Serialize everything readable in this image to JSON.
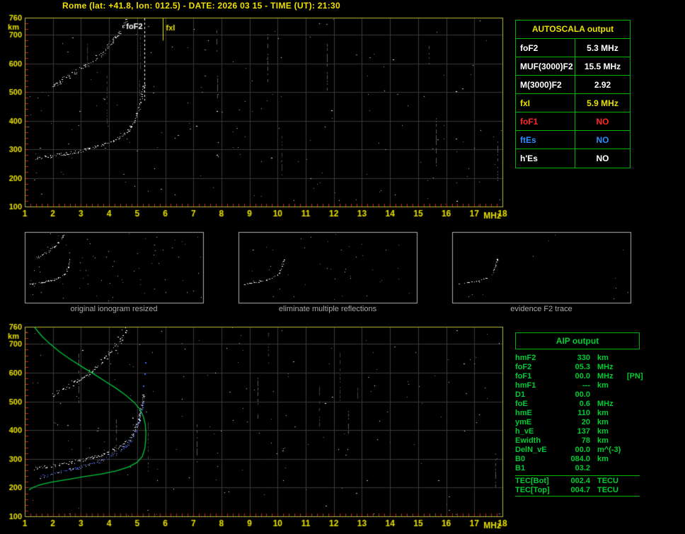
{
  "header": {
    "title": "Rome (lat: +41.8, lon: 012.5) - DATE: 2026 03 15 - TIME (UT): 21:30"
  },
  "colors": {
    "background": "#000000",
    "title": "#f0e000",
    "axis_label": "#e8e000",
    "plot_border": "#b8b83c",
    "grid": "#3a3a3a",
    "tick": "#cc2020",
    "trace": "#ffffff",
    "profile": "#00c83c",
    "restored_trace": "#4664ff",
    "table_border": "#00b400",
    "table_title": "#e8e000",
    "aip_text": "#00cc33",
    "caption": "#a8a8a8",
    "thumb_border": "#b0b0b0",
    "red": "#ff2828",
    "blue": "#2f8cff",
    "white": "#ffffff",
    "yellow": "#e8e000"
  },
  "autoscala_table": {
    "title": "AUTOSCALA output",
    "rows": [
      {
        "label": "foF2",
        "value": "5.3 MHz",
        "label_color": "#ffffff",
        "value_color": "#ffffff"
      },
      {
        "label": "MUF(3000)F2",
        "value": "15.5 MHz",
        "label_color": "#ffffff",
        "value_color": "#ffffff"
      },
      {
        "label": "M(3000)F2",
        "value": "2.92",
        "label_color": "#ffffff",
        "value_color": "#ffffff"
      },
      {
        "label": "fxI",
        "value": "5.9 MHz",
        "label_color": "#e8e000",
        "value_color": "#e8e000"
      },
      {
        "label": "foF1",
        "value": "NO",
        "label_color": "#ff2828",
        "value_color": "#ff2828"
      },
      {
        "label": "ftEs",
        "value": "NO",
        "label_color": "#2f8cff",
        "value_color": "#2f8cff"
      },
      {
        "label": "h'Es",
        "value": "NO",
        "label_color": "#ffffff",
        "value_color": "#ffffff"
      }
    ]
  },
  "thumbnails": [
    {
      "caption": "original ionogram resized",
      "traces": [
        0,
        1
      ],
      "noise": 70,
      "seed": 21
    },
    {
      "caption": "eliminate multiple reflections",
      "traces": [
        0
      ],
      "noise": 45,
      "seed": 22
    },
    {
      "caption": "evidence F2 trace",
      "traces": [
        0
      ],
      "noise": 12,
      "seed": 23
    }
  ],
  "aip_table": {
    "title": "AIP output",
    "rows": [
      {
        "label": "hmF2",
        "value": "330",
        "unit": "km",
        "extra": ""
      },
      {
        "label": "foF2",
        "value": "05.3",
        "unit": "MHz",
        "extra": ""
      },
      {
        "label": "foF1",
        "value": "00.0",
        "unit": "MHz",
        "extra": "[PN]"
      },
      {
        "label": "hmF1",
        "value": "---",
        "unit": "km",
        "extra": ""
      },
      {
        "label": "D1",
        "value": "00.0",
        "unit": "",
        "extra": ""
      },
      {
        "label": "foE",
        "value": "0.6",
        "unit": "MHz",
        "extra": ""
      },
      {
        "label": "hmE",
        "value": "110",
        "unit": "km",
        "extra": ""
      },
      {
        "label": "ymE",
        "value": "20",
        "unit": "km",
        "extra": ""
      },
      {
        "label": "h_vE",
        "value": "137",
        "unit": "km",
        "extra": ""
      },
      {
        "label": "Ewidth",
        "value": "78",
        "unit": "km",
        "extra": ""
      },
      {
        "label": "DelN_vE",
        "value": "00.0",
        "unit": "m^(-3)",
        "extra": ""
      },
      {
        "label": "B0",
        "value": "084.0",
        "unit": "km",
        "extra": ""
      },
      {
        "label": "B1",
        "value": "03.2",
        "unit": "",
        "extra": ""
      }
    ],
    "tec_rows": [
      {
        "label": "TEC[Bot]",
        "value": "002.4",
        "unit": "TECU",
        "extra": ""
      },
      {
        "label": "TEC[Top]",
        "value": "004.7",
        "unit": "TECU",
        "extra": ""
      }
    ]
  },
  "chart_data": [
    {
      "name": "top_ionogram",
      "type": "scatter",
      "title": "recorded ionogram with autoscaled characteristics",
      "xlabel": "MHz",
      "ylabel": "km",
      "xlim": [
        1,
        18
      ],
      "ylim": [
        100,
        760
      ],
      "xticks": [
        1,
        2,
        3,
        4,
        5,
        6,
        7,
        8,
        9,
        10,
        11,
        12,
        13,
        14,
        15,
        16,
        17,
        18
      ],
      "yticks": [
        100,
        200,
        300,
        400,
        500,
        600,
        700,
        760
      ],
      "grid": true,
      "seed": 7,
      "noise_dots": 170,
      "streaks": 12,
      "markers": [
        {
          "label": "foF2",
          "x": 5.25,
          "color": "#ffffff",
          "style": "dashed",
          "line_to_km": 470,
          "label_side": "left"
        },
        {
          "label": "fxI",
          "x": 5.9,
          "color": "#e8e000",
          "style": "solid",
          "line_to_km": 680,
          "label_side": "right"
        }
      ],
      "traces": [
        {
          "name": "F2 ordinary trace",
          "color": "#ffffff",
          "spread_x": 1.5,
          "spread_y": 2.2,
          "density": 0.95,
          "points": [
            [
              1.35,
              268
            ],
            [
              1.7,
              274
            ],
            [
              2.1,
              280
            ],
            [
              2.6,
              288
            ],
            [
              3.0,
              296
            ],
            [
              3.4,
              305
            ],
            [
              3.8,
              316
            ],
            [
              4.1,
              328
            ],
            [
              4.4,
              344
            ],
            [
              4.65,
              362
            ],
            [
              4.82,
              385
            ],
            [
              4.95,
              412
            ],
            [
              5.05,
              442
            ],
            [
              5.13,
              472
            ],
            [
              5.2,
              505
            ],
            [
              5.24,
              528
            ]
          ]
        },
        {
          "name": "F2 second reflection",
          "color": "#ffffff",
          "spread_x": 2.0,
          "spread_y": 3.5,
          "density": 0.8,
          "points": [
            [
              1.95,
              522
            ],
            [
              2.3,
              542
            ],
            [
              2.7,
              564
            ],
            [
              3.05,
              586
            ],
            [
              3.4,
              610
            ],
            [
              3.7,
              634
            ],
            [
              3.95,
              660
            ],
            [
              4.2,
              688
            ],
            [
              4.4,
              714
            ],
            [
              4.55,
              738
            ],
            [
              4.65,
              758
            ]
          ]
        }
      ]
    },
    {
      "name": "bottom_ionogram",
      "type": "scatter",
      "title": "ionogram with restored trace and electron density profile",
      "xlabel": "MHz",
      "ylabel": "km",
      "xlim": [
        1,
        18
      ],
      "ylim": [
        100,
        760
      ],
      "xticks": [
        1,
        2,
        3,
        4,
        5,
        6,
        7,
        8,
        9,
        10,
        11,
        12,
        13,
        14,
        15,
        16,
        17,
        18
      ],
      "yticks": [
        100,
        200,
        300,
        400,
        500,
        600,
        700,
        760
      ],
      "grid": true,
      "seed": 13,
      "noise_dots": 160,
      "streaks": 12,
      "markers": [],
      "traces": [
        {
          "name": "F2 ordinary trace",
          "color": "#ffffff",
          "spread_x": 1.5,
          "spread_y": 2.2,
          "density": 0.95,
          "points": [
            [
              1.35,
              268
            ],
            [
              1.7,
              274
            ],
            [
              2.1,
              280
            ],
            [
              2.6,
              288
            ],
            [
              3.0,
              296
            ],
            [
              3.4,
              305
            ],
            [
              3.8,
              316
            ],
            [
              4.1,
              328
            ],
            [
              4.4,
              344
            ],
            [
              4.65,
              362
            ],
            [
              4.82,
              385
            ],
            [
              4.95,
              412
            ],
            [
              5.05,
              442
            ],
            [
              5.13,
              472
            ],
            [
              5.2,
              505
            ],
            [
              5.24,
              528
            ]
          ]
        },
        {
          "name": "F2 second reflection",
          "color": "#ffffff",
          "spread_x": 2.0,
          "spread_y": 3.5,
          "density": 0.8,
          "points": [
            [
              1.95,
              522
            ],
            [
              2.3,
              542
            ],
            [
              2.7,
              564
            ],
            [
              3.05,
              586
            ],
            [
              3.4,
              610
            ],
            [
              3.7,
              634
            ],
            [
              3.95,
              660
            ],
            [
              4.2,
              688
            ],
            [
              4.4,
              714
            ],
            [
              4.55,
              738
            ],
            [
              4.65,
              758
            ]
          ]
        }
      ],
      "profile": {
        "name": "electron density profile",
        "color": "#00c83c",
        "points": [
          [
            1.35,
            758
          ],
          [
            1.6,
            728
          ],
          [
            1.9,
            700
          ],
          [
            2.25,
            672
          ],
          [
            2.65,
            645
          ],
          [
            3.05,
            620
          ],
          [
            3.45,
            596
          ],
          [
            3.85,
            571
          ],
          [
            4.25,
            546
          ],
          [
            4.6,
            521
          ],
          [
            4.9,
            496
          ],
          [
            5.1,
            472
          ],
          [
            5.22,
            448
          ],
          [
            5.29,
            420
          ],
          [
            5.31,
            390
          ],
          [
            5.3,
            360
          ],
          [
            5.27,
            335
          ],
          [
            5.18,
            308
          ],
          [
            5.0,
            288
          ],
          [
            4.7,
            272
          ],
          [
            4.25,
            258
          ],
          [
            3.7,
            247
          ],
          [
            3.1,
            238
          ],
          [
            2.5,
            228
          ],
          [
            1.95,
            219
          ],
          [
            1.55,
            210
          ],
          [
            1.3,
            201
          ],
          [
            1.15,
            192
          ]
        ]
      },
      "restored": {
        "name": "restored trace",
        "color": "#4664ff",
        "spread_x": 1.2,
        "spread_y": 1.8,
        "density": 0.85,
        "points": [
          [
            1.5,
            236
          ],
          [
            1.9,
            246
          ],
          [
            2.3,
            256
          ],
          [
            2.7,
            265
          ],
          [
            3.1,
            275
          ],
          [
            3.5,
            287
          ],
          [
            3.85,
            300
          ],
          [
            4.15,
            315
          ],
          [
            4.45,
            333
          ],
          [
            4.68,
            354
          ],
          [
            4.85,
            378
          ],
          [
            4.98,
            405
          ],
          [
            5.08,
            436
          ],
          [
            5.16,
            468
          ],
          [
            5.21,
            500
          ]
        ],
        "extra": [
          [
            5.2,
            555
          ],
          [
            5.25,
            598
          ],
          [
            5.28,
            636
          ]
        ]
      }
    }
  ]
}
